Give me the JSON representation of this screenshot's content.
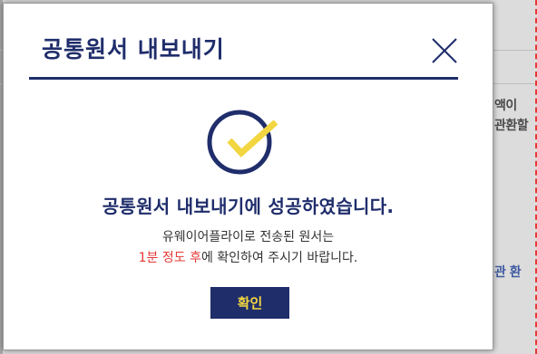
{
  "background": {
    "lines": [
      "액이",
      "관환할",
      "관 환"
    ]
  },
  "dialog": {
    "title": "공통원서 내보내기",
    "close_icon": "close-icon",
    "status_icon": "check-circle-icon",
    "headline": "공통원서 내보내기에 성공하였습니다.",
    "message_line1": "유웨이어플라이로 전송된 원서는",
    "message_line2_highlight": "1분 정도 후",
    "message_line2_rest": "에 확인하여 주시기 바랍니다.",
    "ok_label": "확인"
  },
  "colors": {
    "navy": "#1f2d6b",
    "yellow": "#f2d640",
    "highlight_red": "#e53935"
  }
}
